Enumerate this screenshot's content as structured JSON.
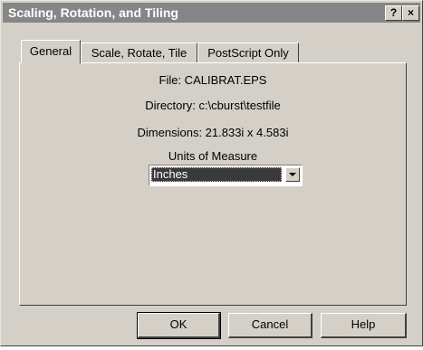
{
  "window": {
    "title": "Scaling, Rotation, and Tiling",
    "help_button": "?",
    "close_button": "×"
  },
  "tabs": [
    {
      "label": "General",
      "active": true
    },
    {
      "label": "Scale, Rotate, Tile",
      "active": false
    },
    {
      "label": "PostScript Only",
      "active": false
    }
  ],
  "general": {
    "file": "File: CALIBRAT.EPS",
    "directory": "Directory: c:\\cburst\\testfile",
    "dimensions": "Dimensions: 21.833i x 4.583i",
    "units_label": "Units of Measure",
    "units_value": "Inches"
  },
  "buttons": {
    "ok": "OK",
    "cancel": "Cancel",
    "help": "Help"
  }
}
